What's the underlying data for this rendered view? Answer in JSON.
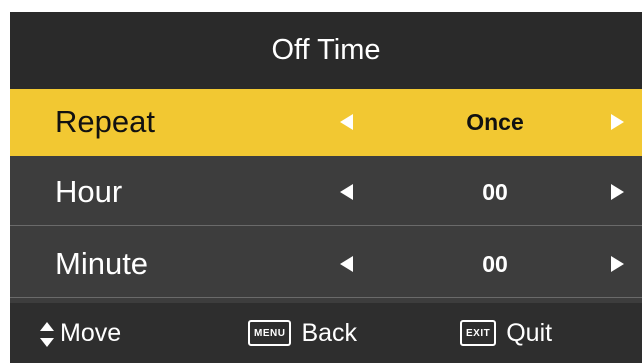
{
  "menu": {
    "title": "Off Time",
    "rows": [
      {
        "label": "Repeat",
        "value": "Once",
        "selected": true
      },
      {
        "label": "Hour",
        "value": "00",
        "selected": false
      },
      {
        "label": "Minute",
        "value": "00",
        "selected": false
      }
    ]
  },
  "footer": {
    "move_label": "Move",
    "menu_key": "MENU",
    "back_label": "Back",
    "exit_key": "EXIT",
    "quit_label": "Quit"
  },
  "colors": {
    "selected_row": "#f2c832",
    "panel": "#3d3d3d",
    "title_bar": "#2a2a2a"
  }
}
